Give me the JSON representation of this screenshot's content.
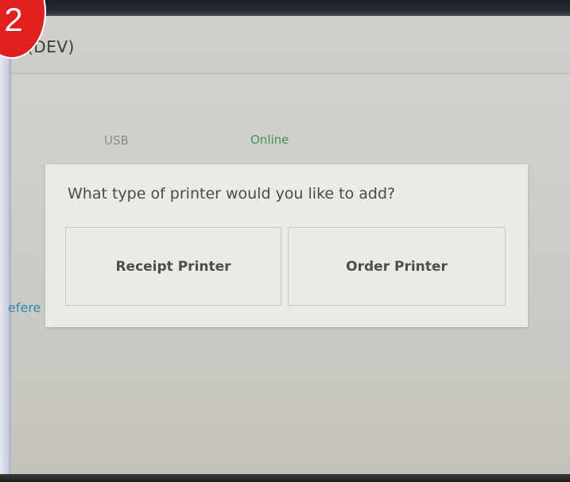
{
  "header": {
    "title": "(DEV)"
  },
  "printer_row": {
    "connection": "USB",
    "status": "Online"
  },
  "preferences_link": "efere",
  "dialog": {
    "title": "What type of printer would you like to add?",
    "options": [
      {
        "label": "Receipt Printer"
      },
      {
        "label": "Order Printer"
      }
    ]
  },
  "step_badge": {
    "number": "2",
    "color": "#e01f1f"
  },
  "colors": {
    "status_online": "#3f9a57",
    "link": "#2e8bb8"
  }
}
